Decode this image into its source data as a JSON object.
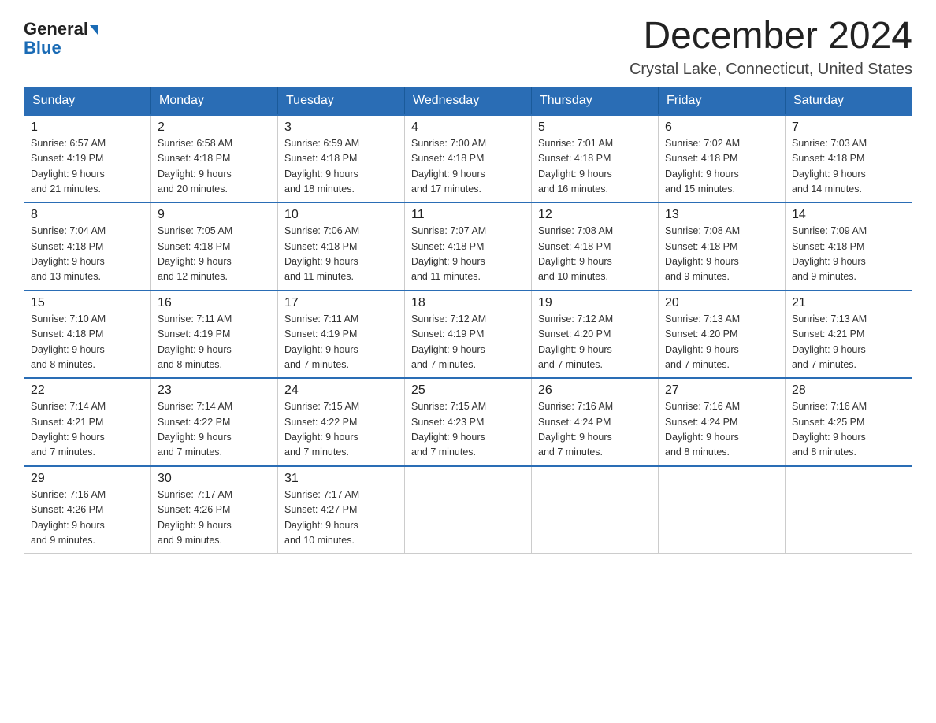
{
  "header": {
    "logo_line1": "General",
    "logo_line2": "Blue",
    "month_title": "December 2024",
    "location": "Crystal Lake, Connecticut, United States"
  },
  "days_of_week": [
    "Sunday",
    "Monday",
    "Tuesday",
    "Wednesday",
    "Thursday",
    "Friday",
    "Saturday"
  ],
  "weeks": [
    [
      {
        "day": "1",
        "sunrise": "6:57 AM",
        "sunset": "4:19 PM",
        "daylight": "9 hours and 21 minutes."
      },
      {
        "day": "2",
        "sunrise": "6:58 AM",
        "sunset": "4:18 PM",
        "daylight": "9 hours and 20 minutes."
      },
      {
        "day": "3",
        "sunrise": "6:59 AM",
        "sunset": "4:18 PM",
        "daylight": "9 hours and 18 minutes."
      },
      {
        "day": "4",
        "sunrise": "7:00 AM",
        "sunset": "4:18 PM",
        "daylight": "9 hours and 17 minutes."
      },
      {
        "day": "5",
        "sunrise": "7:01 AM",
        "sunset": "4:18 PM",
        "daylight": "9 hours and 16 minutes."
      },
      {
        "day": "6",
        "sunrise": "7:02 AM",
        "sunset": "4:18 PM",
        "daylight": "9 hours and 15 minutes."
      },
      {
        "day": "7",
        "sunrise": "7:03 AM",
        "sunset": "4:18 PM",
        "daylight": "9 hours and 14 minutes."
      }
    ],
    [
      {
        "day": "8",
        "sunrise": "7:04 AM",
        "sunset": "4:18 PM",
        "daylight": "9 hours and 13 minutes."
      },
      {
        "day": "9",
        "sunrise": "7:05 AM",
        "sunset": "4:18 PM",
        "daylight": "9 hours and 12 minutes."
      },
      {
        "day": "10",
        "sunrise": "7:06 AM",
        "sunset": "4:18 PM",
        "daylight": "9 hours and 11 minutes."
      },
      {
        "day": "11",
        "sunrise": "7:07 AM",
        "sunset": "4:18 PM",
        "daylight": "9 hours and 11 minutes."
      },
      {
        "day": "12",
        "sunrise": "7:08 AM",
        "sunset": "4:18 PM",
        "daylight": "9 hours and 10 minutes."
      },
      {
        "day": "13",
        "sunrise": "7:08 AM",
        "sunset": "4:18 PM",
        "daylight": "9 hours and 9 minutes."
      },
      {
        "day": "14",
        "sunrise": "7:09 AM",
        "sunset": "4:18 PM",
        "daylight": "9 hours and 9 minutes."
      }
    ],
    [
      {
        "day": "15",
        "sunrise": "7:10 AM",
        "sunset": "4:18 PM",
        "daylight": "9 hours and 8 minutes."
      },
      {
        "day": "16",
        "sunrise": "7:11 AM",
        "sunset": "4:19 PM",
        "daylight": "9 hours and 8 minutes."
      },
      {
        "day": "17",
        "sunrise": "7:11 AM",
        "sunset": "4:19 PM",
        "daylight": "9 hours and 7 minutes."
      },
      {
        "day": "18",
        "sunrise": "7:12 AM",
        "sunset": "4:19 PM",
        "daylight": "9 hours and 7 minutes."
      },
      {
        "day": "19",
        "sunrise": "7:12 AM",
        "sunset": "4:20 PM",
        "daylight": "9 hours and 7 minutes."
      },
      {
        "day": "20",
        "sunrise": "7:13 AM",
        "sunset": "4:20 PM",
        "daylight": "9 hours and 7 minutes."
      },
      {
        "day": "21",
        "sunrise": "7:13 AM",
        "sunset": "4:21 PM",
        "daylight": "9 hours and 7 minutes."
      }
    ],
    [
      {
        "day": "22",
        "sunrise": "7:14 AM",
        "sunset": "4:21 PM",
        "daylight": "9 hours and 7 minutes."
      },
      {
        "day": "23",
        "sunrise": "7:14 AM",
        "sunset": "4:22 PM",
        "daylight": "9 hours and 7 minutes."
      },
      {
        "day": "24",
        "sunrise": "7:15 AM",
        "sunset": "4:22 PM",
        "daylight": "9 hours and 7 minutes."
      },
      {
        "day": "25",
        "sunrise": "7:15 AM",
        "sunset": "4:23 PM",
        "daylight": "9 hours and 7 minutes."
      },
      {
        "day": "26",
        "sunrise": "7:16 AM",
        "sunset": "4:24 PM",
        "daylight": "9 hours and 7 minutes."
      },
      {
        "day": "27",
        "sunrise": "7:16 AM",
        "sunset": "4:24 PM",
        "daylight": "9 hours and 8 minutes."
      },
      {
        "day": "28",
        "sunrise": "7:16 AM",
        "sunset": "4:25 PM",
        "daylight": "9 hours and 8 minutes."
      }
    ],
    [
      {
        "day": "29",
        "sunrise": "7:16 AM",
        "sunset": "4:26 PM",
        "daylight": "9 hours and 9 minutes."
      },
      {
        "day": "30",
        "sunrise": "7:17 AM",
        "sunset": "4:26 PM",
        "daylight": "9 hours and 9 minutes."
      },
      {
        "day": "31",
        "sunrise": "7:17 AM",
        "sunset": "4:27 PM",
        "daylight": "9 hours and 10 minutes."
      },
      null,
      null,
      null,
      null
    ]
  ],
  "labels": {
    "sunrise": "Sunrise:",
    "sunset": "Sunset:",
    "daylight": "Daylight:"
  }
}
